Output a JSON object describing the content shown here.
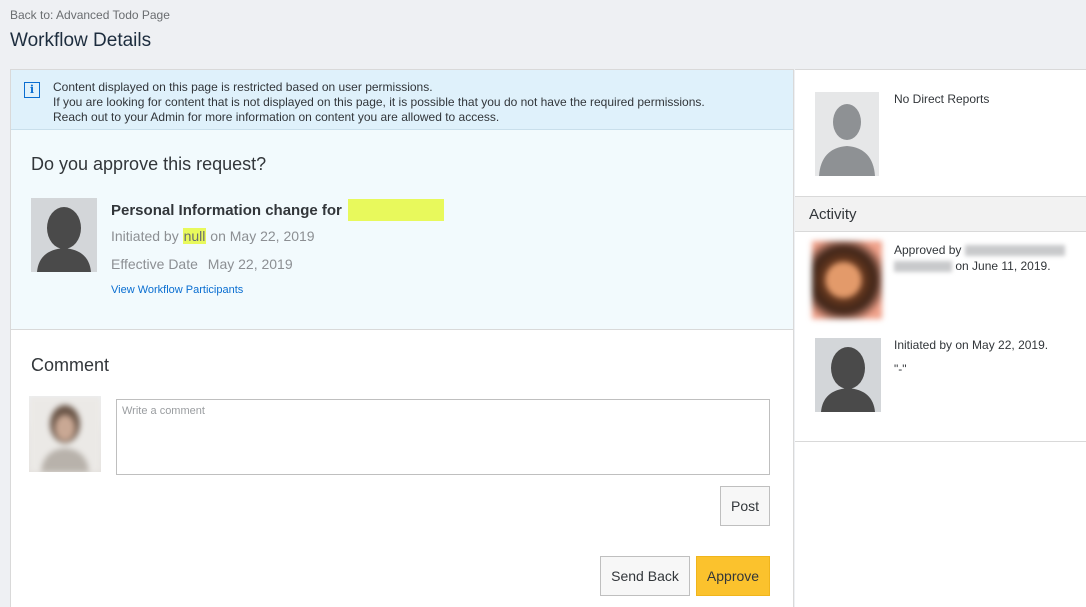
{
  "header": {
    "back_prefix": "Back to:",
    "back_target": "Advanced Todo Page",
    "title": "Workflow Details"
  },
  "info_banner": {
    "line1": "Content displayed on this page is restricted based on user permissions.",
    "line2": "If you are looking for content that is not displayed on this page, it is possible that you do not have the required permissions.",
    "line3": "Reach out to your Admin for more information on content you are allowed to access."
  },
  "request": {
    "question": "Do you approve this request?",
    "title": "Personal Information change for",
    "initiated_prefix": "Initiated by",
    "initiated_by": "null",
    "initiated_suffix": "on May 22, 2019",
    "effective_label": "Effective Date",
    "effective_value": "May 22, 2019",
    "participants_link": "View Workflow Participants"
  },
  "comment": {
    "title": "Comment",
    "placeholder": "Write a comment",
    "post_label": "Post"
  },
  "actions": {
    "send_back_label": "Send Back",
    "approve_label": "Approve",
    "approve_color": "#fbc22d"
  },
  "side": {
    "no_reports": "No Direct Reports",
    "activity_title": "Activity",
    "activity": [
      {
        "prefix": "Approved by",
        "suffix": "on June 11, 2019."
      },
      {
        "text": "Initiated by on May 22, 2019.",
        "quote": "\"-\""
      }
    ]
  },
  "icons": {
    "info": "info-icon",
    "avatar": "person-silhouette-icon"
  },
  "colors": {
    "accent": "#0a6ed1",
    "banner_bg": "#dff1fb",
    "highlight": "#e8f95c"
  }
}
